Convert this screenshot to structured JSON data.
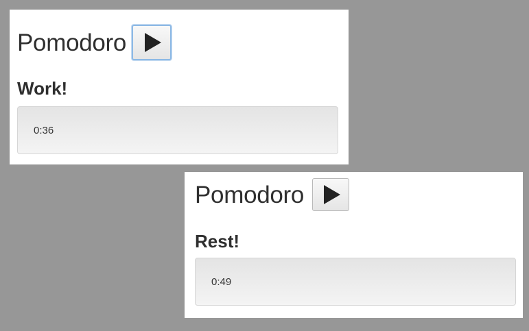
{
  "windows": [
    {
      "title": "Pomodoro",
      "phase": "Work!",
      "timer": "0:36",
      "play_icon": "play-icon",
      "play_button_focused": true
    },
    {
      "title": "Pomodoro",
      "phase": "Rest!",
      "timer": "0:49",
      "play_icon": "play-icon",
      "play_button_focused": false
    }
  ],
  "colors": {
    "background": "#979797",
    "panel": "#ffffff",
    "text": "#2f2f2f",
    "focus_ring": "#8db9e5"
  }
}
